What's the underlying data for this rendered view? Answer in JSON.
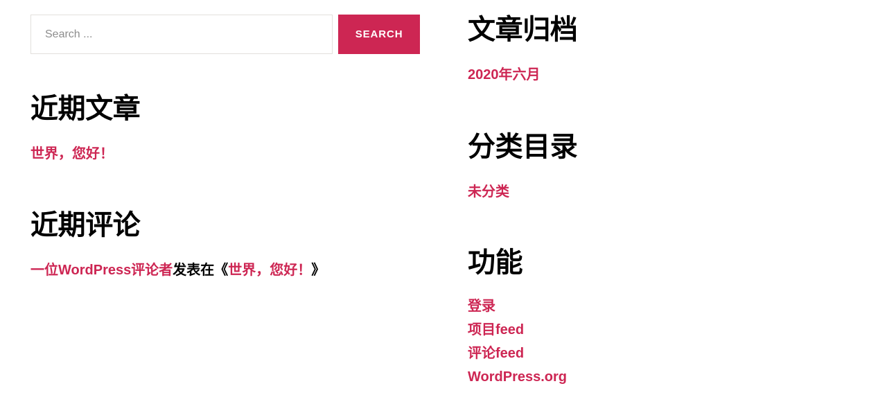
{
  "search": {
    "placeholder": "Search ...",
    "value": "",
    "submit_label": "SEARCH",
    "accent_color": "#cd2653"
  },
  "colors": {
    "accent": "#cd2653",
    "text": "#000000",
    "placeholder": "#8d8d8d",
    "border": "#e2e0dc",
    "background": "#ffffff"
  },
  "left_column": {
    "recent_posts": {
      "title": "近期文章",
      "items": [
        {
          "label": "世界，您好！"
        }
      ]
    },
    "recent_comments": {
      "title": "近期评论",
      "items": [
        {
          "author": "一位WordPress评论者",
          "connector": "发表在",
          "open_bracket": "《",
          "post": "世界，您好！",
          "close_bracket": "》"
        }
      ]
    }
  },
  "right_column": {
    "archives": {
      "title": "文章归档",
      "items": [
        {
          "label": "2020年六月"
        }
      ]
    },
    "categories": {
      "title": "分类目录",
      "items": [
        {
          "label": "未分类"
        }
      ]
    },
    "meta": {
      "title": "功能",
      "items": [
        {
          "label": "登录"
        },
        {
          "label": "项目feed"
        },
        {
          "label": "评论feed"
        },
        {
          "label": "WordPress.org"
        }
      ]
    }
  }
}
